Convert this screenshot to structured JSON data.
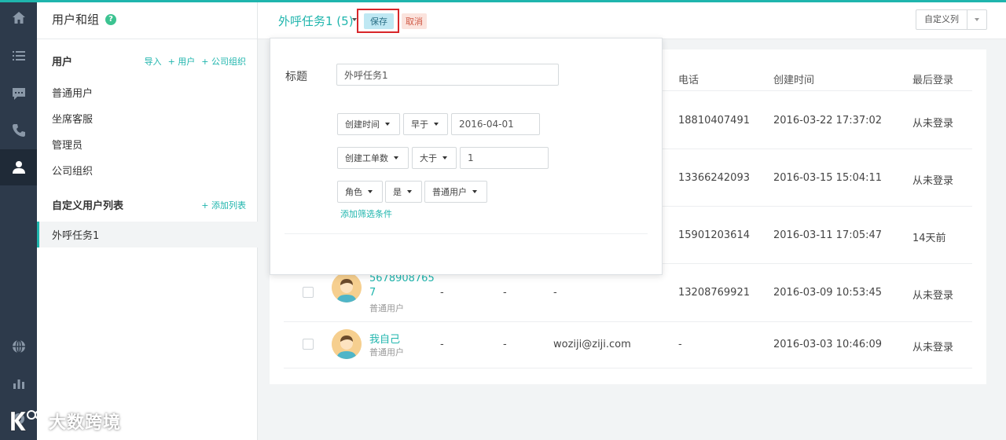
{
  "sidebar": {
    "header_title": "用户和组",
    "help_symbol": "?",
    "users_section_title": "用户",
    "users_links": [
      "导入",
      "+ 用户",
      "+ 公司组织"
    ],
    "groups": [
      "普通用户",
      "坐席客服",
      "管理员",
      "公司组织"
    ],
    "custom_section_title": "自定义用户列表",
    "custom_add_link": "+ 添加列表",
    "custom_lists": [
      "外呼任务1"
    ]
  },
  "rail_icons": [
    "home-icon",
    "list-icon",
    "chat-icon",
    "phone-icon",
    "user-icon",
    "globe-icon",
    "bar-chart-icon",
    "settings-icon"
  ],
  "topbar": {
    "list_title": "外呼任务1 (5)",
    "save_label": "保存",
    "cancel_label": "取消",
    "custom_columns_label": "自定义列"
  },
  "panel": {
    "title_label": "标题",
    "title_value": "外呼任务1",
    "filters": [
      {
        "field": "创建时间",
        "operator": "早于",
        "value": "2016-04-01"
      },
      {
        "field": "创建工单数",
        "operator": "大于",
        "value": "1"
      },
      {
        "field": "角色",
        "operator": "是",
        "value": "普通用户"
      }
    ],
    "add_filter_label": "添加筛选条件"
  },
  "table": {
    "columns": [
      "电话",
      "创建时间",
      "最后登录"
    ],
    "rows": [
      {
        "phone": "18810407491",
        "created": "2016-03-22 17:37:02",
        "last_login": "从未登录"
      },
      {
        "phone": "13366242093",
        "created": "2016-03-15 15:04:11",
        "last_login": "从未登录"
      },
      {
        "phone": "15901203614",
        "created": "2016-03-11 17:05:47",
        "last_login": "14天前"
      },
      {
        "name_line1": "5678908765",
        "name_line2": "7",
        "role": "普通用户",
        "col_a": "-",
        "col_b": "-",
        "email": "-",
        "phone": "13208769921",
        "created": "2016-03-09 10:53:45",
        "last_login": "从未登录"
      },
      {
        "name_line1": "我自己",
        "role": "普通用户",
        "col_a": "-",
        "col_b": "-",
        "email": "woziji@ziji.com",
        "phone": "-",
        "created": "2016-03-03 10:46:09",
        "last_login": "从未登录"
      }
    ]
  },
  "watermark": {
    "text": "大数跨境"
  },
  "colors": {
    "accent": "#1fb5ad",
    "rail": "#2d3a4b",
    "highlight": "#d8262a"
  }
}
